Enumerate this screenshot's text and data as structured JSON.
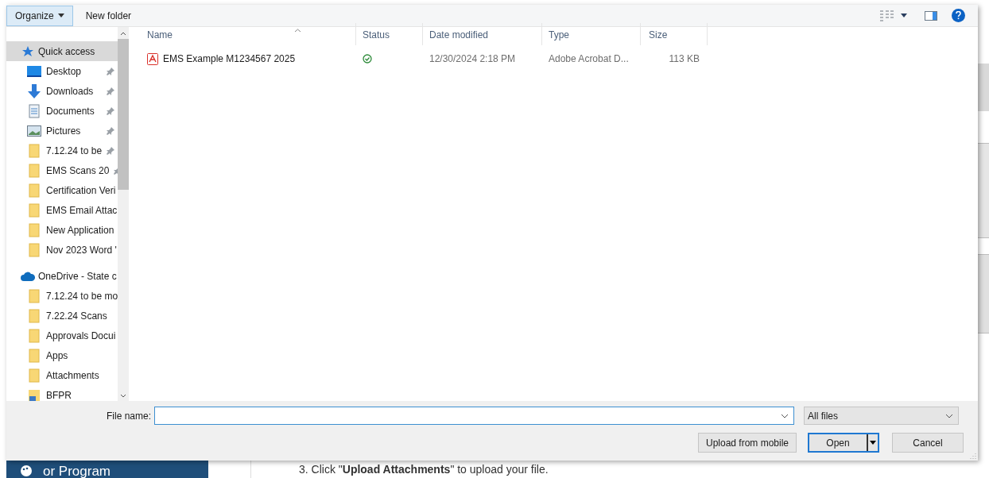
{
  "toolbar": {
    "organize": "Organize",
    "new_folder": "New folder"
  },
  "navigation": {
    "groups": [
      {
        "items": [
          {
            "label": "Quick access",
            "kind": "star",
            "pinned": false,
            "selected": true
          },
          {
            "label": "Desktop",
            "kind": "desktop",
            "pinned": true,
            "selected": false
          },
          {
            "label": "Downloads",
            "kind": "download",
            "pinned": true,
            "selected": false
          },
          {
            "label": "Documents",
            "kind": "document",
            "pinned": true,
            "selected": false
          },
          {
            "label": "Pictures",
            "kind": "pictures",
            "pinned": true,
            "selected": false
          },
          {
            "label": "7.12.24 to be",
            "kind": "folder",
            "pinned": true,
            "selected": false
          },
          {
            "label": "EMS Scans 20",
            "kind": "folder",
            "pinned": true,
            "selected": false
          },
          {
            "label": "Certification Veri",
            "kind": "folder",
            "pinned": false,
            "selected": false
          },
          {
            "label": "EMS Email Attac",
            "kind": "folder",
            "pinned": false,
            "selected": false
          },
          {
            "label": "New Application",
            "kind": "folder",
            "pinned": false,
            "selected": false
          },
          {
            "label": "Nov 2023 Word '",
            "kind": "folder",
            "pinned": false,
            "selected": false
          }
        ]
      },
      {
        "items": [
          {
            "label": "OneDrive - State c",
            "kind": "cloud",
            "pinned": false,
            "selected": false
          },
          {
            "label": "7.12.24 to be mo",
            "kind": "folder",
            "pinned": false,
            "selected": false
          },
          {
            "label": "7.22.24 Scans",
            "kind": "folder",
            "pinned": false,
            "selected": false
          },
          {
            "label": "Approvals Docui",
            "kind": "folder",
            "pinned": false,
            "selected": false
          },
          {
            "label": "Apps",
            "kind": "folder",
            "pinned": false,
            "selected": false
          },
          {
            "label": "Attachments",
            "kind": "folder",
            "pinned": false,
            "selected": false
          },
          {
            "label": "BFPR",
            "kind": "shared-folder",
            "pinned": false,
            "selected": false
          }
        ]
      }
    ]
  },
  "file_list": {
    "columns": [
      "Name",
      "Status",
      "Date modified",
      "Type",
      "Size"
    ],
    "rows": [
      {
        "name": "EMS Example M1234567 2025",
        "synced": true,
        "date_modified": "12/30/2024 2:18 PM",
        "type": "Adobe Acrobat D...",
        "size": "113 KB"
      }
    ]
  },
  "footer": {
    "file_name_label": "File name:",
    "file_type": "All files",
    "buttons": [
      {
        "label": "Upload from mobile",
        "kind": "plain"
      },
      {
        "label": "Open",
        "kind": "split-default"
      },
      {
        "label": "Cancel",
        "kind": "plain"
      }
    ]
  },
  "background_page": {
    "sidebar_text": "or Program",
    "instruction": "3. Click \"**Upload Attachments**\" to upload your file."
  }
}
